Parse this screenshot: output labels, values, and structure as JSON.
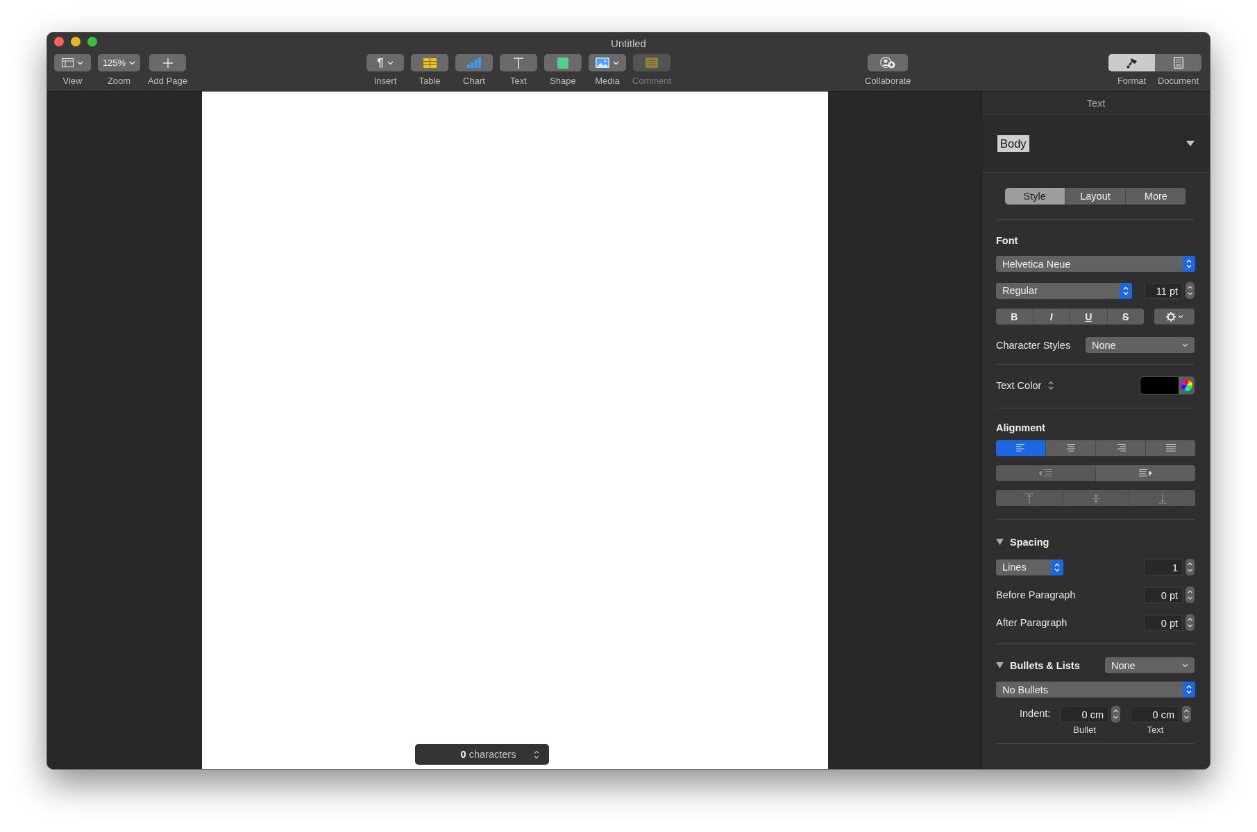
{
  "window": {
    "title": "Untitled"
  },
  "toolbar": {
    "left": [
      {
        "kind": "view",
        "label": "View"
      },
      {
        "kind": "zoom",
        "label": "Zoom",
        "value": "125%"
      },
      {
        "kind": "add",
        "label": "Add Page"
      }
    ],
    "center": [
      {
        "kind": "insert",
        "label": "Insert",
        "glyph": "¶",
        "disabled": false
      },
      {
        "kind": "table",
        "label": "Table",
        "disabled": false
      },
      {
        "kind": "chart",
        "label": "Chart",
        "disabled": false
      },
      {
        "kind": "text",
        "label": "Text",
        "disabled": false
      },
      {
        "kind": "shape",
        "label": "Shape",
        "disabled": false
      },
      {
        "kind": "media",
        "label": "Media",
        "disabled": false
      },
      {
        "kind": "comment",
        "label": "Comment",
        "disabled": true
      }
    ],
    "collaborate": {
      "label": "Collaborate"
    },
    "inspector_tabs": [
      {
        "kind": "format",
        "label": "Format",
        "selected": true
      },
      {
        "kind": "document",
        "label": "Document",
        "selected": false
      }
    ]
  },
  "document": {
    "counter": {
      "count": "0",
      "unit": "characters"
    }
  },
  "inspector": {
    "title": "Text",
    "paragraph_style": "Body",
    "tabs": [
      {
        "label": "Style",
        "selected": true
      },
      {
        "label": "Layout",
        "selected": false
      },
      {
        "label": "More",
        "selected": false
      }
    ],
    "font": {
      "heading": "Font",
      "family": "Helvetica Neue",
      "typeface": "Regular",
      "size": "11 pt",
      "styles": [
        {
          "kind": "bold",
          "label": "B"
        },
        {
          "kind": "italic",
          "label": "I"
        },
        {
          "kind": "underline",
          "label": "U"
        },
        {
          "kind": "strike",
          "label": "S"
        }
      ]
    },
    "character_styles": {
      "label": "Character Styles",
      "value": "None"
    },
    "text_color": {
      "label": "Text Color",
      "color": "#000000"
    },
    "alignment": {
      "heading": "Alignment",
      "horizontal": [
        {
          "kind": "left",
          "selected": true
        },
        {
          "kind": "center",
          "selected": false
        },
        {
          "kind": "right",
          "selected": false
        },
        {
          "kind": "justify",
          "selected": false
        }
      ],
      "indent": [
        {
          "kind": "decrease",
          "disabled": true
        },
        {
          "kind": "increase",
          "disabled": false
        }
      ],
      "vertical": [
        {
          "kind": "top",
          "disabled": true
        },
        {
          "kind": "middle",
          "disabled": true
        },
        {
          "kind": "bottom",
          "disabled": true
        }
      ]
    },
    "spacing": {
      "heading": "Spacing",
      "expanded": true,
      "mode": "Lines",
      "value": "1",
      "before": {
        "label": "Before Paragraph",
        "value": "0 pt"
      },
      "after": {
        "label": "After Paragraph",
        "value": "0 pt"
      }
    },
    "bullets": {
      "heading": "Bullets & Lists",
      "expanded": true,
      "preset": "None",
      "type": "No Bullets",
      "indent_label": "Indent:",
      "indents": [
        {
          "value": "0 cm",
          "caption": "Bullet"
        },
        {
          "value": "0 cm",
          "caption": "Text"
        }
      ]
    }
  }
}
